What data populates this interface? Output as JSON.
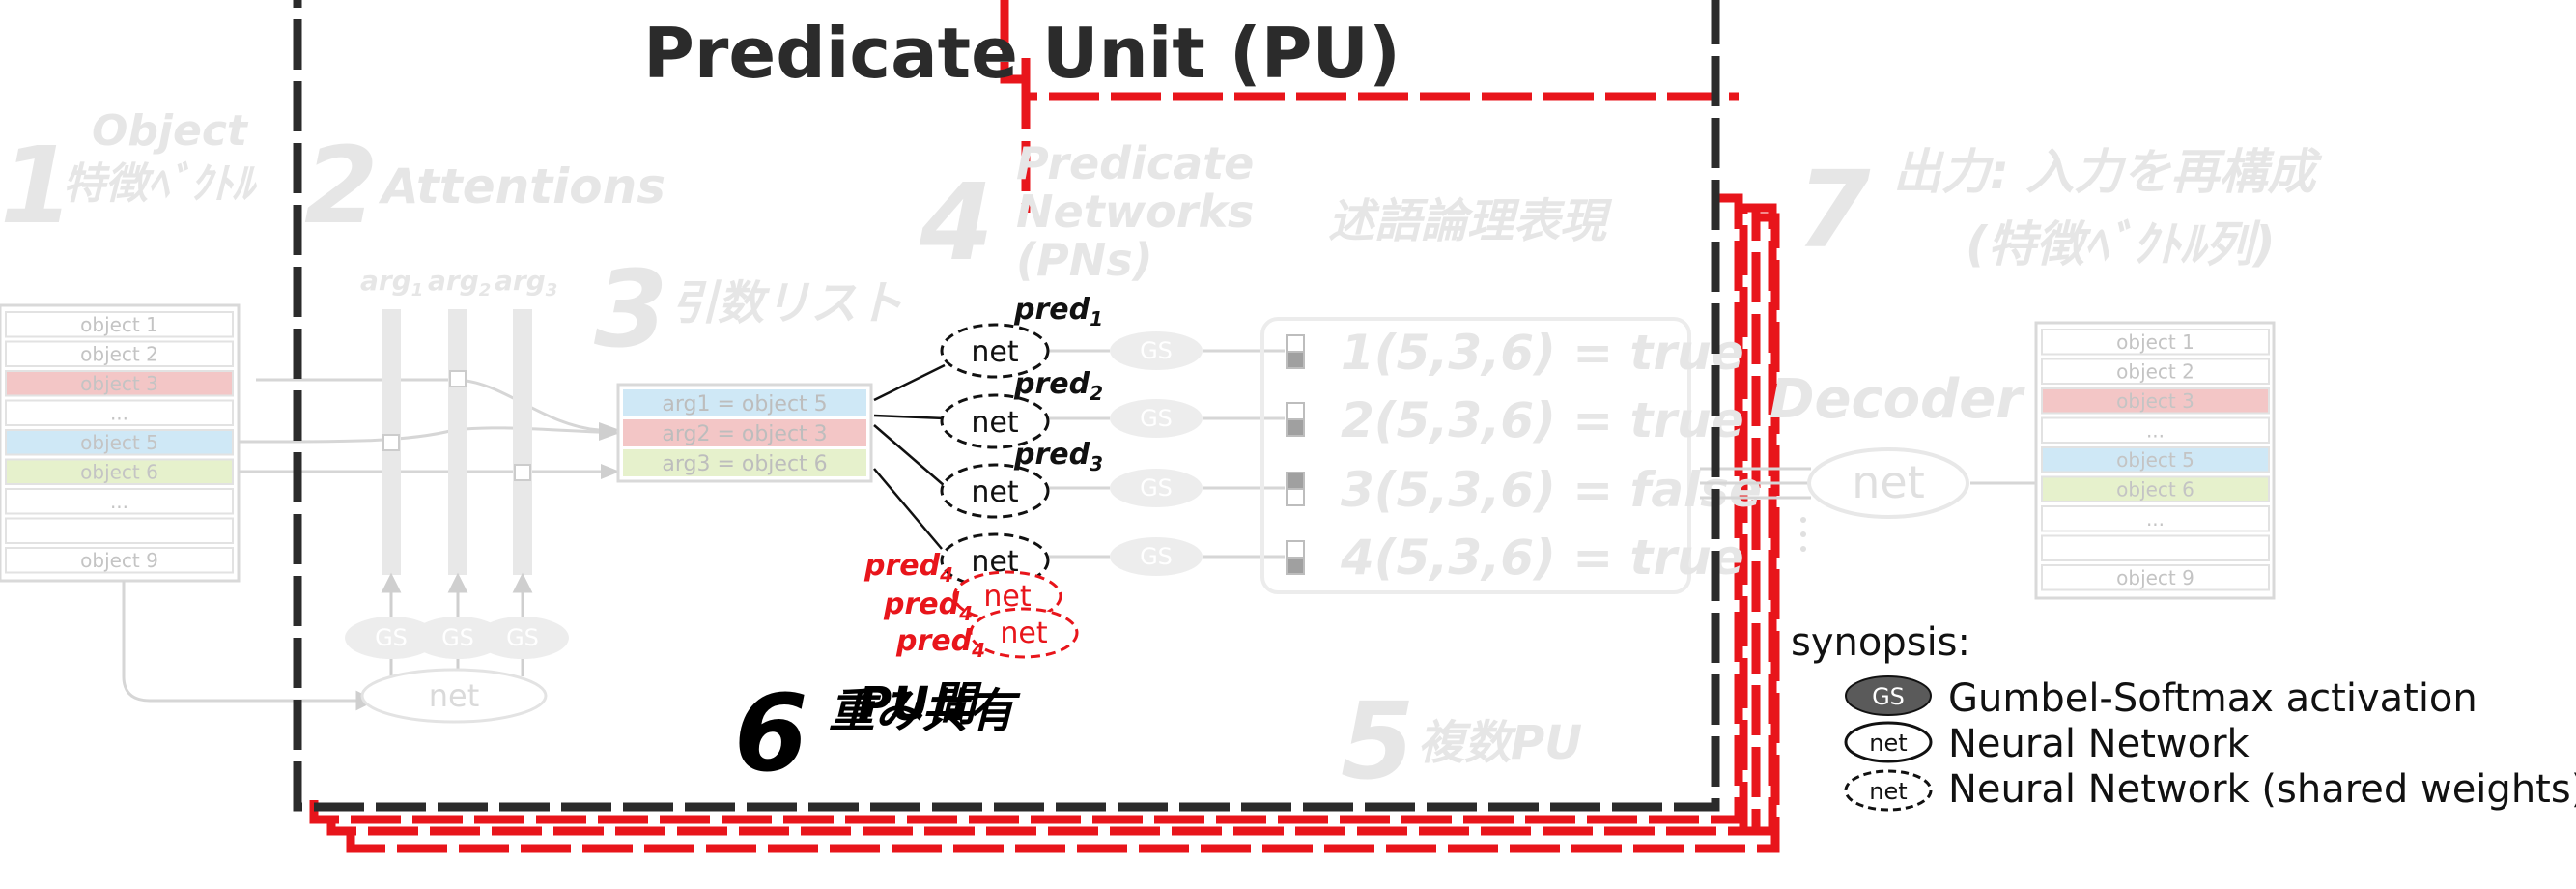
{
  "title": "Predicate Unit (PU)",
  "steps": {
    "s1": {
      "num": "1",
      "line1": "Object",
      "line2": "特徴ﾍﾞｸﾄﾙ"
    },
    "s2": {
      "num": "2",
      "label": "Attentions"
    },
    "s3": {
      "num": "3",
      "label": "引数リスト"
    },
    "s4": {
      "num": "4",
      "line1": "Predicate",
      "line2": "Networks",
      "line3": "(PNs)"
    },
    "s5": {
      "num": "5",
      "label": "複数PU"
    },
    "s6": {
      "num": "6",
      "label": "重み共有"
    },
    "s7": {
      "num": "7",
      "line1": "出力: 入力を再構成",
      "line2": "(特徴ﾍﾞｸﾄﾙ列)"
    },
    "overlap_label": "PU間"
  },
  "logic_header": "述語論理表現",
  "decoder_label": "Decoder",
  "objects_left": [
    "object 1",
    "object 2",
    "object 3",
    "...",
    "object 5",
    "object 6",
    "...",
    "",
    "object 9"
  ],
  "objects_right": [
    "object 1",
    "object 2",
    "object 3",
    "...",
    "object 5",
    "object 6",
    "...",
    "",
    "object 9"
  ],
  "arg_labels": [
    {
      "base": "arg",
      "sub": "1"
    },
    {
      "base": "arg",
      "sub": "2"
    },
    {
      "base": "arg",
      "sub": "3"
    }
  ],
  "arg_list": [
    "arg1 = object 5",
    "arg2 = object 3",
    "arg3 = object 6"
  ],
  "pred_labels": [
    {
      "base": "pred",
      "sub": "1"
    },
    {
      "base": "pred",
      "sub": "2"
    },
    {
      "base": "pred",
      "sub": "3"
    },
    {
      "base": "pred",
      "sub": "4"
    }
  ],
  "shared_pred_labels": [
    {
      "base": "pred",
      "sub": "4"
    },
    {
      "base": "pred",
      "sub": "4"
    }
  ],
  "net_label": "net",
  "gs_label": "GS",
  "logic_rows": [
    "1(5,3,6) = true",
    "2(5,3,6) = true",
    "3(5,3,6) = false",
    "4(5,3,6) = true"
  ],
  "synopsis": {
    "title": "synopsis:",
    "items": [
      {
        "icon": "GS",
        "text": "Gumbel-Softmax activation"
      },
      {
        "icon": "net",
        "text": "Neural Network"
      },
      {
        "icon": "net",
        "text": "Neural Network (shared weights)"
      }
    ]
  },
  "colors": {
    "frame": "#2b2b2b",
    "red": "#e8151b",
    "faded": "#e6e6e6",
    "pink": "#f3c6c6",
    "blue": "#cfe8f6",
    "green": "#e6f1cc",
    "gs_fill": "#5a5a5a"
  }
}
